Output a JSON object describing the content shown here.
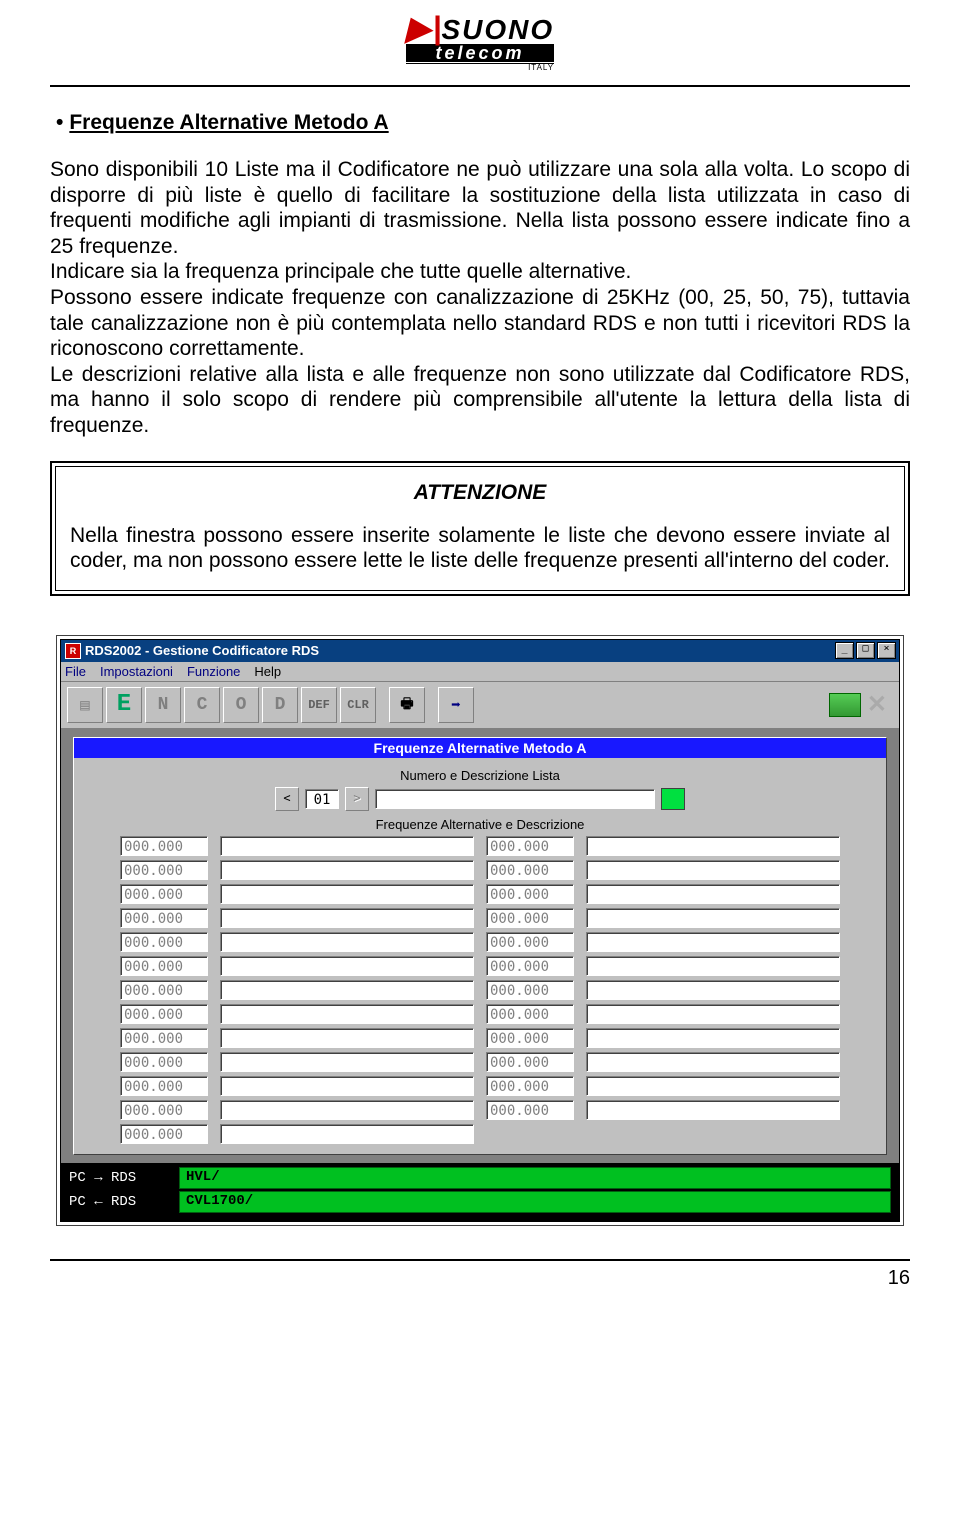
{
  "logo": {
    "line1_red": "▶|",
    "line1": "SUONO",
    "line2": "telecom",
    "line3": "ITALY"
  },
  "doc": {
    "title": "Frequenze Alternative Metodo A",
    "para": "Sono disponibili 10 Liste ma il Codificatore ne può utilizzare una sola alla volta. Lo scopo di disporre di più liste è quello di facilitare la sostituzione della lista utilizzata in caso di frequenti modifiche agli impianti di trasmissione. Nella lista possono essere indicate fino a 25 frequenze.\nIndicare sia la frequenza principale che tutte quelle alternative.\nPossono essere indicate frequenze con canalizzazione di 25KHz (00, 25, 50, 75), tuttavia tale canalizzazione non è più contemplata nello standard RDS e non tutti i ricevitori RDS la riconoscono correttamente.\nLe descrizioni relative alla lista e alle frequenze non sono utilizzate dal Codificatore RDS, ma hanno il solo scopo di rendere più comprensibile all'utente la lettura della lista di frequenze."
  },
  "attn": {
    "title": "ATTENZIONE",
    "body": "Nella finestra possono essere inserite solamente le liste che devono essere inviate al coder, ma non possono essere lette le liste delle frequenze presenti all'interno del coder."
  },
  "app": {
    "title": "RDS2002 - Gestione Codificatore RDS",
    "menu": [
      "File",
      "Impostazioni",
      "Funzione",
      "Help"
    ],
    "toolbar_letters": [
      "",
      "E",
      "N",
      "C",
      "O",
      "D",
      "DEF",
      "CLR"
    ],
    "panel_title": "Frequenze Alternative Metodo A",
    "section1": "Numero e Descrizione Lista",
    "list_number": "01",
    "list_desc": "",
    "nav_prev": "<",
    "nav_next": ">",
    "section2": "Frequenze Alternative e Descrizione",
    "left_freqs": [
      "000.000",
      "000.000",
      "000.000",
      "000.000",
      "000.000",
      "000.000",
      "000.000",
      "000.000",
      "000.000",
      "000.000",
      "000.000",
      "000.000",
      "000.000"
    ],
    "right_freqs": [
      "000.000",
      "000.000",
      "000.000",
      "000.000",
      "000.000",
      "000.000",
      "000.000",
      "000.000",
      "000.000",
      "000.000",
      "000.000",
      "000.000"
    ],
    "status_tx_label": "PC → RDS",
    "status_tx_value": "HVL/",
    "status_rx_label": "PC ← RDS",
    "status_rx_value": "CVL1700/"
  },
  "page_no": "16"
}
